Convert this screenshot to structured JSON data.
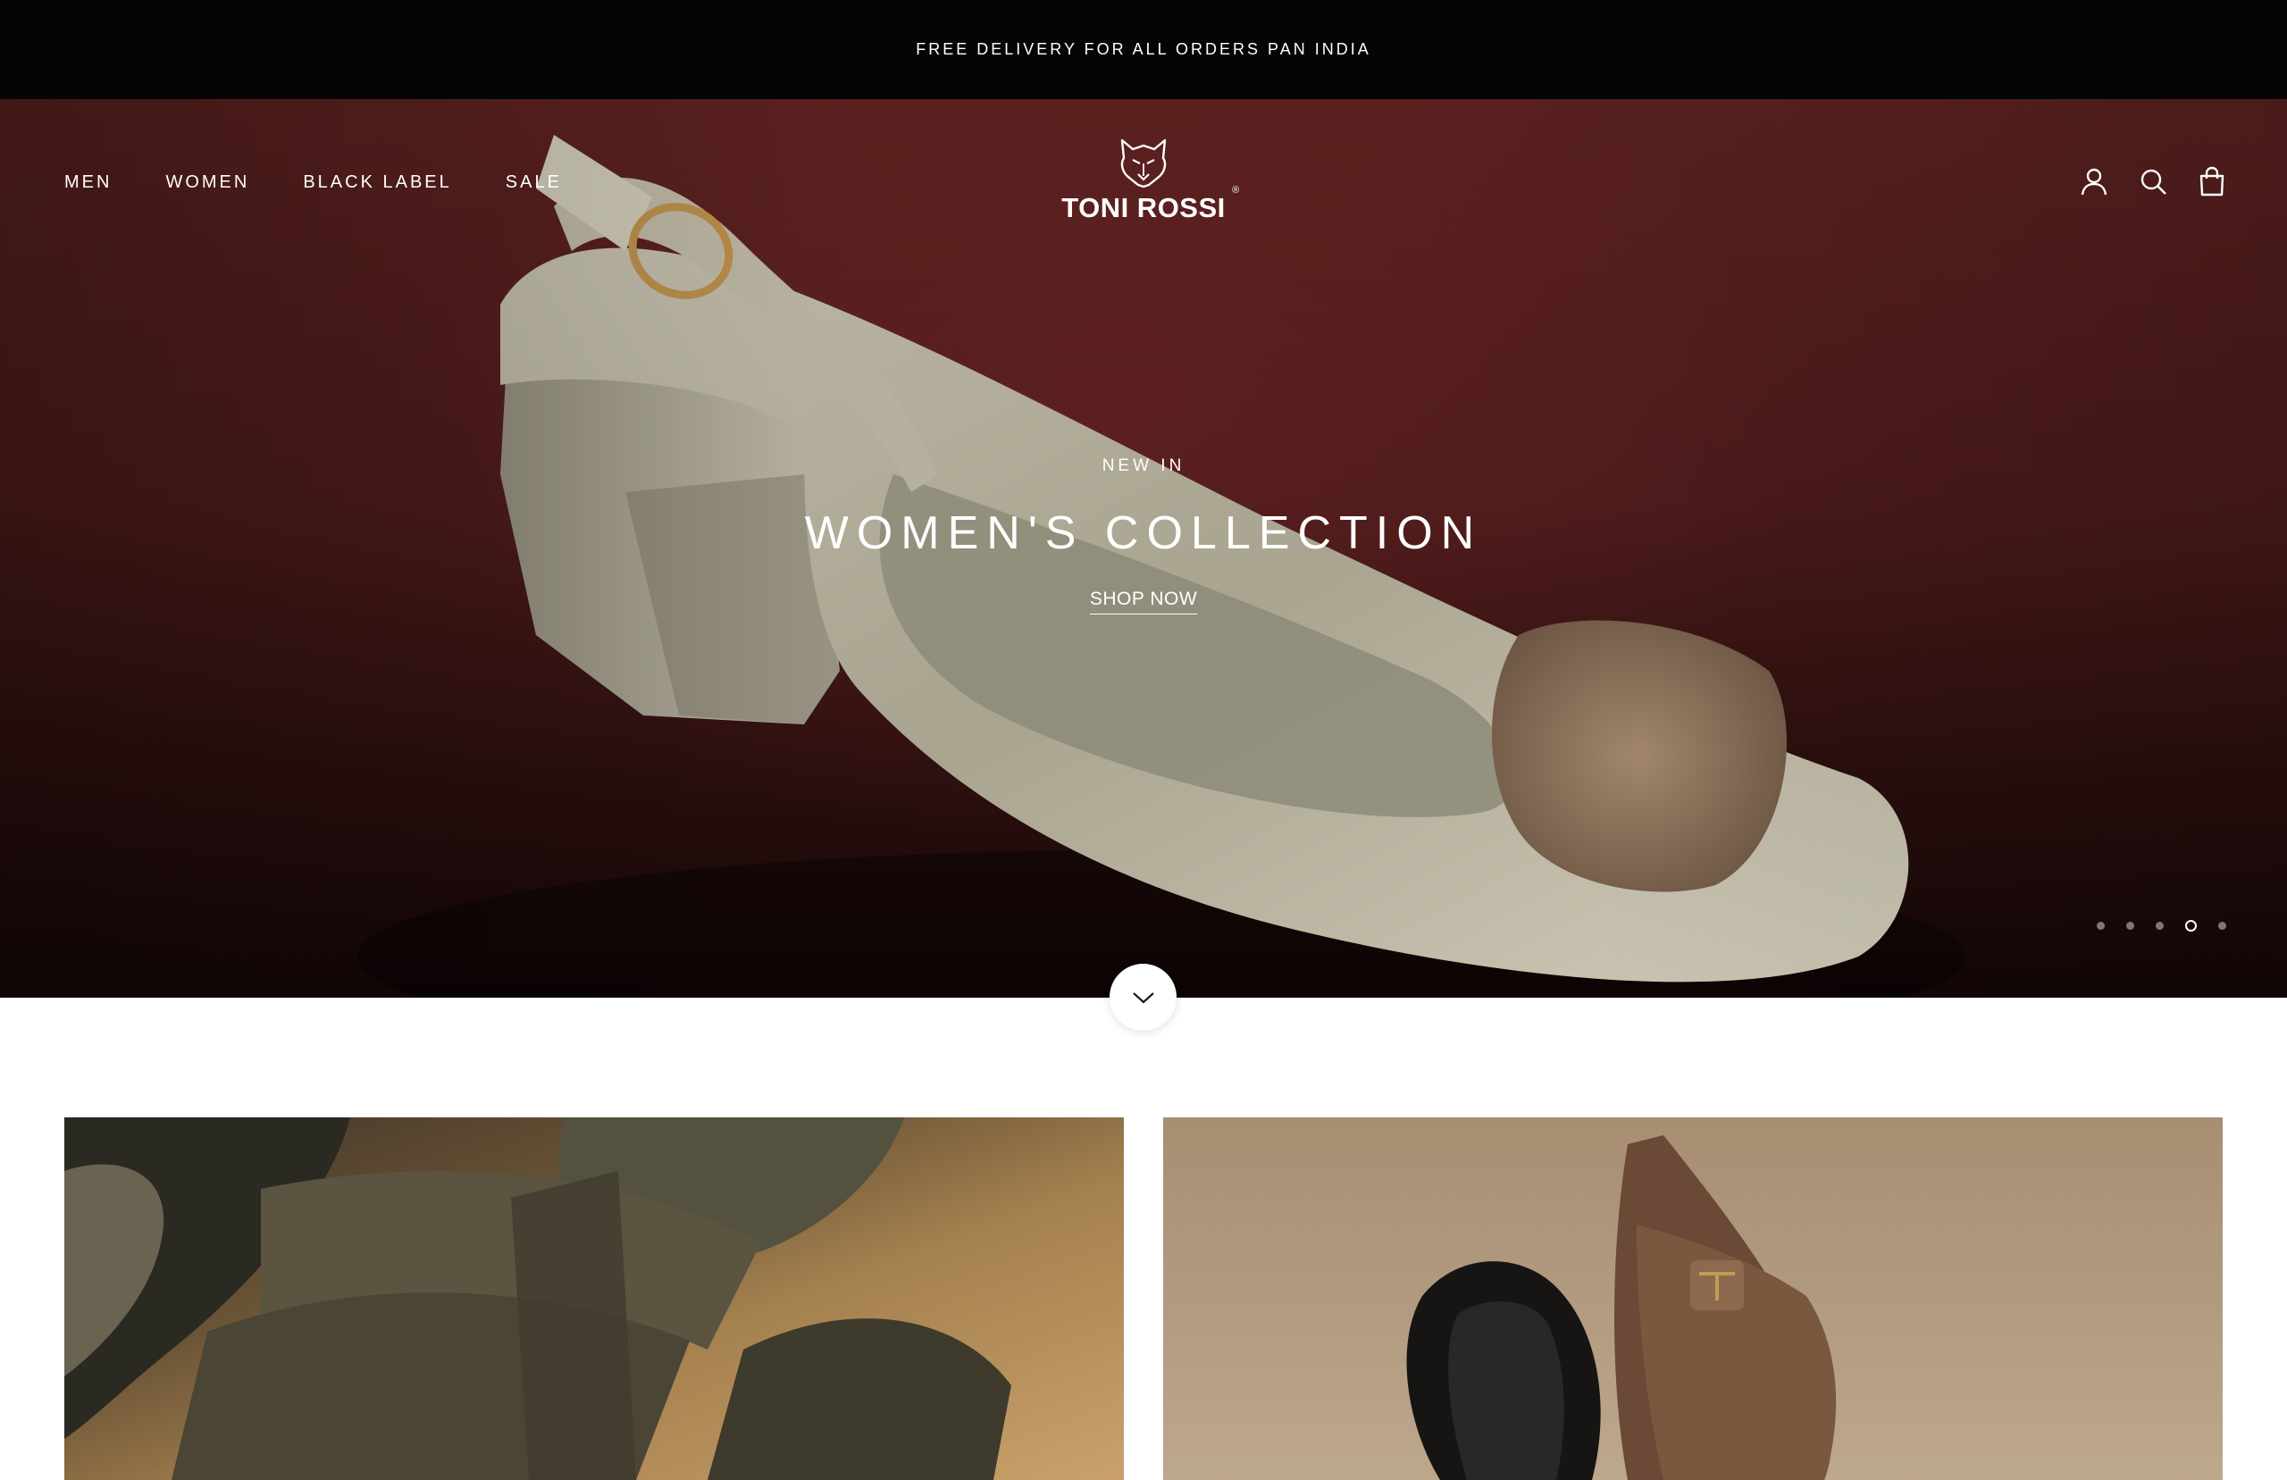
{
  "announcement": {
    "text": "FREE DELIVERY FOR ALL ORDERS PAN INDIA"
  },
  "header": {
    "nav": [
      {
        "label": "MEN"
      },
      {
        "label": "WOMEN"
      },
      {
        "label": "BLACK LABEL"
      },
      {
        "label": "SALE"
      }
    ],
    "logo": {
      "text": "TONI ROSSI",
      "registered": "®",
      "icon": "wolf-icon"
    },
    "icons": [
      "account-icon",
      "search-icon",
      "cart-icon"
    ]
  },
  "hero": {
    "eyebrow": "NEW IN",
    "title": "WOMEN'S COLLECTION",
    "cta": "SHOP NOW",
    "slides_total": 5,
    "active_slide": 4,
    "image": "cream slingback block heel with embellished toe on maroon background"
  },
  "scroll_button": {
    "icon": "chevron-down-icon"
  },
  "tiles": [
    {
      "image": "olive cross-strap sandals"
    },
    {
      "image": "black and brown pointed mules"
    }
  ],
  "colors": {
    "announcement_bg": "#050505",
    "hero_bg": "#4a1a1a",
    "text_light": "#ffffff"
  }
}
